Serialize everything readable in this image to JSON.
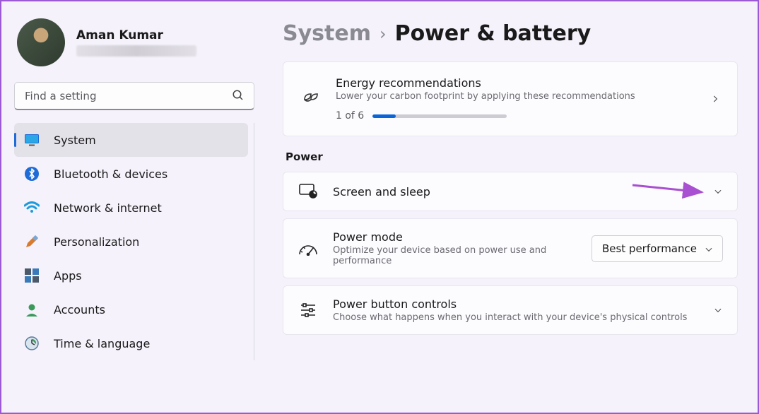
{
  "profile": {
    "name": "Aman Kumar"
  },
  "search": {
    "placeholder": "Find a setting"
  },
  "sidebar": {
    "items": [
      {
        "label": "System",
        "icon": "system",
        "active": true
      },
      {
        "label": "Bluetooth & devices",
        "icon": "bluetooth"
      },
      {
        "label": "Network & internet",
        "icon": "wifi"
      },
      {
        "label": "Personalization",
        "icon": "brush"
      },
      {
        "label": "Apps",
        "icon": "apps"
      },
      {
        "label": "Accounts",
        "icon": "accounts"
      },
      {
        "label": "Time & language",
        "icon": "time"
      }
    ]
  },
  "breadcrumb": {
    "parent": "System",
    "current": "Power & battery"
  },
  "energy": {
    "title": "Energy recommendations",
    "sub": "Lower your carbon footprint by applying these recommendations",
    "progress_text": "1 of 6",
    "progress_pct": 17
  },
  "section_power": "Power",
  "screen_sleep": {
    "title": "Screen and sleep"
  },
  "power_mode": {
    "title": "Power mode",
    "sub": "Optimize your device based on power use and performance",
    "value": "Best performance"
  },
  "power_button": {
    "title": "Power button controls",
    "sub": "Choose what happens when you interact with your device's physical controls"
  }
}
